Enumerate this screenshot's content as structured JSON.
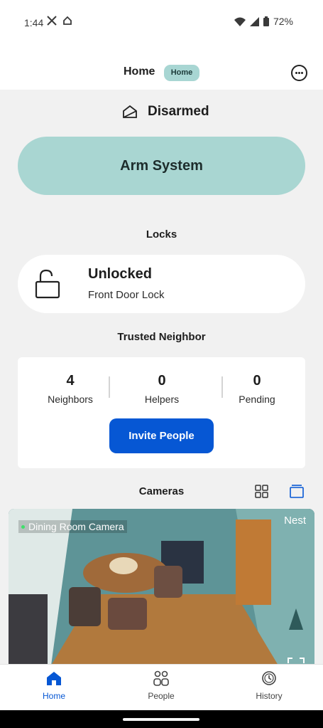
{
  "status_bar": {
    "time": "1:44",
    "battery": "72%"
  },
  "header": {
    "title": "Home",
    "badge": "Home"
  },
  "security": {
    "state": "Disarmed",
    "arm_button": "Arm System"
  },
  "locks": {
    "section_title": "Locks",
    "status": "Unlocked",
    "name": "Front Door Lock"
  },
  "trusted_neighbor": {
    "section_title": "Trusted Neighbor",
    "stats": [
      {
        "value": "4",
        "label": "Neighbors"
      },
      {
        "value": "0",
        "label": "Helpers"
      },
      {
        "value": "0",
        "label": "Pending"
      }
    ],
    "invite_button": "Invite People"
  },
  "cameras": {
    "section_title": "Cameras",
    "camera_name": "Dining Room Camera",
    "brand": "Nest"
  },
  "bottom_nav": {
    "items": [
      {
        "label": "Home"
      },
      {
        "label": "People"
      },
      {
        "label": "History"
      }
    ]
  },
  "colors": {
    "accent": "#0657d4",
    "arm": "#a9d6d2",
    "badge": "#a8d6d3"
  }
}
